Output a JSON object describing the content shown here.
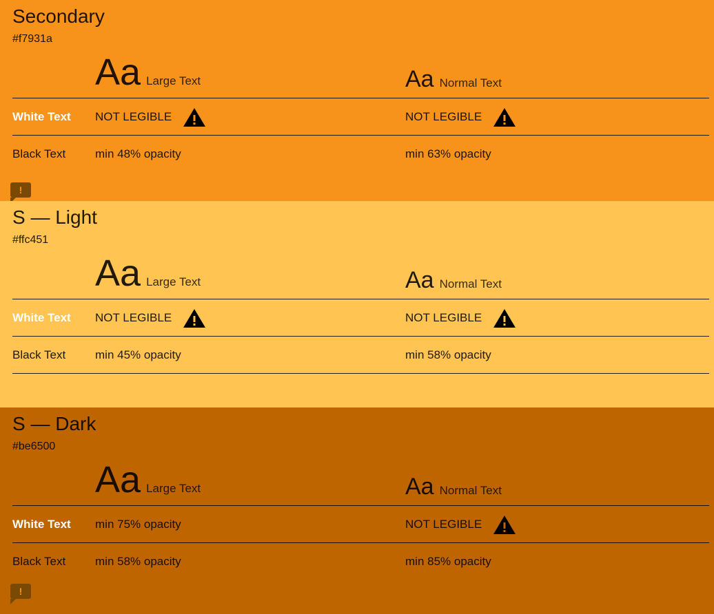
{
  "labels": {
    "large_text": "Large Text",
    "normal_text": "Normal Text",
    "aa": "Aa",
    "white_text": "White Text",
    "black_text": "Black Text"
  },
  "panels": [
    {
      "title": "Secondary",
      "hex": "#f7931a",
      "bg": "#f7931a",
      "white": {
        "large": "NOT LEGIBLE",
        "large_warning": true,
        "normal": "NOT LEGIBLE",
        "normal_warning": true
      },
      "black": {
        "large": "min 48% opacity",
        "normal": "min 63% opacity"
      }
    },
    {
      "title": "S — Light",
      "hex": "#ffc451",
      "bg": "#ffc451",
      "white": {
        "large": "NOT LEGIBLE",
        "large_warning": true,
        "normal": "NOT LEGIBLE",
        "normal_warning": true
      },
      "black": {
        "large": "min 45% opacity",
        "normal": "min 58% opacity"
      }
    },
    {
      "title": "S — Dark",
      "hex": "#be6500",
      "bg": "#be6500",
      "white": {
        "large": "min 75% opacity",
        "large_warning": false,
        "normal": "NOT LEGIBLE",
        "normal_warning": true
      },
      "black": {
        "large": "min 58% opacity",
        "normal": "min 85% opacity"
      }
    }
  ],
  "comment_badge": "!"
}
